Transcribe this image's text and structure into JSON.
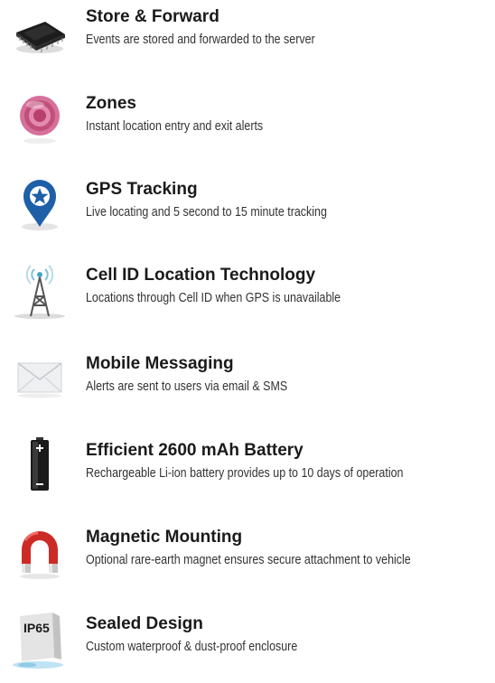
{
  "features": [
    {
      "icon": "memory-chip-icon",
      "title": "Store & Forward",
      "description": "Events are stored and forwarded to the server"
    },
    {
      "icon": "zone-target-icon",
      "title": "Zones",
      "description": "Instant location entry and exit alerts"
    },
    {
      "icon": "map-pin-icon",
      "title": "GPS Tracking",
      "description": "Live locating and 5 second to 15 minute tracking"
    },
    {
      "icon": "cell-tower-icon",
      "title": "Cell ID Location Technology",
      "description": "Locations through Cell ID when GPS is unavailable"
    },
    {
      "icon": "envelope-icon",
      "title": "Mobile Messaging",
      "description": "Alerts are sent to users via email & SMS"
    },
    {
      "icon": "battery-icon",
      "title": "Efficient 2600 mAh Battery",
      "description": "Rechargeable Li-ion battery provides up to 10 days of operation"
    },
    {
      "icon": "magnet-icon",
      "title": "Magnetic Mounting",
      "description": "Optional rare-earth magnet ensures secure attachment to vehicle"
    },
    {
      "icon": "ip65-box-icon",
      "title": "Sealed Design",
      "description": "Custom waterproof & dust-proof enclosure",
      "badge": "IP65"
    }
  ],
  "colors": {
    "title": "#1a1a1a",
    "description": "#333333",
    "pin": "#1e5fa8",
    "zone": "#c0507a",
    "magnet": "#cc2b25"
  }
}
